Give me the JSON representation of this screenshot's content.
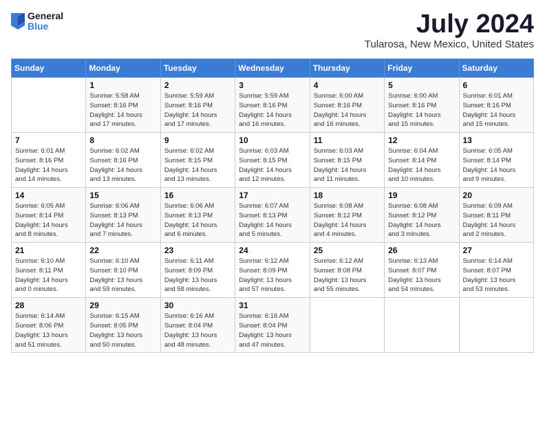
{
  "logo": {
    "general": "General",
    "blue": "Blue"
  },
  "title": "July 2024",
  "location": "Tularosa, New Mexico, United States",
  "days_of_week": [
    "Sunday",
    "Monday",
    "Tuesday",
    "Wednesday",
    "Thursday",
    "Friday",
    "Saturday"
  ],
  "weeks": [
    [
      {
        "day": "",
        "info": ""
      },
      {
        "day": "1",
        "info": "Sunrise: 5:58 AM\nSunset: 8:16 PM\nDaylight: 14 hours\nand 17 minutes."
      },
      {
        "day": "2",
        "info": "Sunrise: 5:59 AM\nSunset: 8:16 PM\nDaylight: 14 hours\nand 17 minutes."
      },
      {
        "day": "3",
        "info": "Sunrise: 5:59 AM\nSunset: 8:16 PM\nDaylight: 14 hours\nand 16 minutes."
      },
      {
        "day": "4",
        "info": "Sunrise: 6:00 AM\nSunset: 8:16 PM\nDaylight: 14 hours\nand 16 minutes."
      },
      {
        "day": "5",
        "info": "Sunrise: 6:00 AM\nSunset: 8:16 PM\nDaylight: 14 hours\nand 15 minutes."
      },
      {
        "day": "6",
        "info": "Sunrise: 6:01 AM\nSunset: 8:16 PM\nDaylight: 14 hours\nand 15 minutes."
      }
    ],
    [
      {
        "day": "7",
        "info": "Sunrise: 6:01 AM\nSunset: 8:16 PM\nDaylight: 14 hours\nand 14 minutes."
      },
      {
        "day": "8",
        "info": "Sunrise: 6:02 AM\nSunset: 8:16 PM\nDaylight: 14 hours\nand 13 minutes."
      },
      {
        "day": "9",
        "info": "Sunrise: 6:02 AM\nSunset: 8:15 PM\nDaylight: 14 hours\nand 13 minutes."
      },
      {
        "day": "10",
        "info": "Sunrise: 6:03 AM\nSunset: 8:15 PM\nDaylight: 14 hours\nand 12 minutes."
      },
      {
        "day": "11",
        "info": "Sunrise: 6:03 AM\nSunset: 8:15 PM\nDaylight: 14 hours\nand 11 minutes."
      },
      {
        "day": "12",
        "info": "Sunrise: 6:04 AM\nSunset: 8:14 PM\nDaylight: 14 hours\nand 10 minutes."
      },
      {
        "day": "13",
        "info": "Sunrise: 6:05 AM\nSunset: 8:14 PM\nDaylight: 14 hours\nand 9 minutes."
      }
    ],
    [
      {
        "day": "14",
        "info": "Sunrise: 6:05 AM\nSunset: 8:14 PM\nDaylight: 14 hours\nand 8 minutes."
      },
      {
        "day": "15",
        "info": "Sunrise: 6:06 AM\nSunset: 8:13 PM\nDaylight: 14 hours\nand 7 minutes."
      },
      {
        "day": "16",
        "info": "Sunrise: 6:06 AM\nSunset: 8:13 PM\nDaylight: 14 hours\nand 6 minutes."
      },
      {
        "day": "17",
        "info": "Sunrise: 6:07 AM\nSunset: 8:13 PM\nDaylight: 14 hours\nand 5 minutes."
      },
      {
        "day": "18",
        "info": "Sunrise: 6:08 AM\nSunset: 8:12 PM\nDaylight: 14 hours\nand 4 minutes."
      },
      {
        "day": "19",
        "info": "Sunrise: 6:08 AM\nSunset: 8:12 PM\nDaylight: 14 hours\nand 3 minutes."
      },
      {
        "day": "20",
        "info": "Sunrise: 6:09 AM\nSunset: 8:11 PM\nDaylight: 14 hours\nand 2 minutes."
      }
    ],
    [
      {
        "day": "21",
        "info": "Sunrise: 6:10 AM\nSunset: 8:11 PM\nDaylight: 14 hours\nand 0 minutes."
      },
      {
        "day": "22",
        "info": "Sunrise: 6:10 AM\nSunset: 8:10 PM\nDaylight: 13 hours\nand 59 minutes."
      },
      {
        "day": "23",
        "info": "Sunrise: 6:11 AM\nSunset: 8:09 PM\nDaylight: 13 hours\nand 58 minutes."
      },
      {
        "day": "24",
        "info": "Sunrise: 6:12 AM\nSunset: 8:09 PM\nDaylight: 13 hours\nand 57 minutes."
      },
      {
        "day": "25",
        "info": "Sunrise: 6:12 AM\nSunset: 8:08 PM\nDaylight: 13 hours\nand 55 minutes."
      },
      {
        "day": "26",
        "info": "Sunrise: 6:13 AM\nSunset: 8:07 PM\nDaylight: 13 hours\nand 54 minutes."
      },
      {
        "day": "27",
        "info": "Sunrise: 6:14 AM\nSunset: 8:07 PM\nDaylight: 13 hours\nand 53 minutes."
      }
    ],
    [
      {
        "day": "28",
        "info": "Sunrise: 6:14 AM\nSunset: 8:06 PM\nDaylight: 13 hours\nand 51 minutes."
      },
      {
        "day": "29",
        "info": "Sunrise: 6:15 AM\nSunset: 8:05 PM\nDaylight: 13 hours\nand 50 minutes."
      },
      {
        "day": "30",
        "info": "Sunrise: 6:16 AM\nSunset: 8:04 PM\nDaylight: 13 hours\nand 48 minutes."
      },
      {
        "day": "31",
        "info": "Sunrise: 6:16 AM\nSunset: 8:04 PM\nDaylight: 13 hours\nand 47 minutes."
      },
      {
        "day": "",
        "info": ""
      },
      {
        "day": "",
        "info": ""
      },
      {
        "day": "",
        "info": ""
      }
    ]
  ]
}
